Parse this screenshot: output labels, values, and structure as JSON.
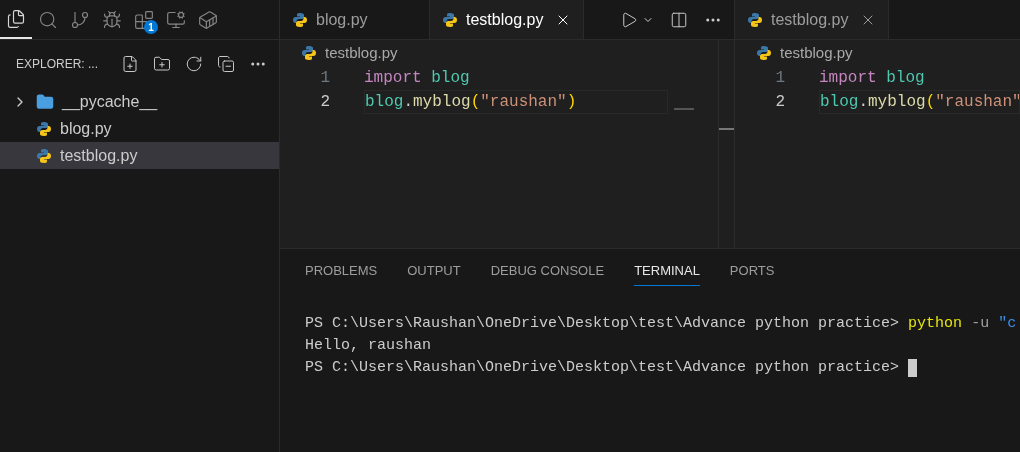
{
  "activity_bar": [
    {
      "kind": "files",
      "selected": true
    },
    {
      "kind": "search",
      "selected": false
    },
    {
      "kind": "source-control",
      "selected": false
    },
    {
      "kind": "run",
      "selected": false
    },
    {
      "kind": "extensions",
      "selected": false,
      "badge": "1"
    },
    {
      "kind": "remote",
      "selected": false
    },
    {
      "kind": "docker",
      "selected": false
    }
  ],
  "sidebar": {
    "title": "EXPLORER: ...",
    "items": [
      {
        "kind": "folder",
        "label": "__pycache__",
        "expanded": false,
        "selected": false
      },
      {
        "kind": "file",
        "label": "blog.py",
        "selected": false
      },
      {
        "kind": "file",
        "label": "testblog.py",
        "selected": true
      }
    ]
  },
  "editor_groups": [
    {
      "tabs": [
        {
          "label": "blog.py",
          "selected": false
        },
        {
          "label": "testblog.py",
          "selected": true
        }
      ],
      "actions": [
        {
          "kind": "run"
        },
        {
          "kind": "split"
        },
        {
          "kind": "more"
        }
      ],
      "breadcrumb": "testblog.py",
      "lines": [
        {
          "number": "1",
          "current": false,
          "tokens": [
            {
              "kind": "keyword",
              "text": "import "
            },
            {
              "kind": "module",
              "text": "blog"
            }
          ]
        },
        {
          "number": "2",
          "current": true,
          "tokens": [
            {
              "kind": "module",
              "text": "blog"
            },
            {
              "kind": "plain",
              "text": "."
            },
            {
              "kind": "function",
              "text": "myblog"
            },
            {
              "kind": "paren",
              "text": "("
            },
            {
              "kind": "string",
              "text": "\"raushan\""
            },
            {
              "kind": "paren",
              "text": ")"
            }
          ]
        }
      ]
    },
    {
      "tabs": [
        {
          "label": "testblog.py",
          "selected": true
        }
      ],
      "breadcrumb": "testblog.py",
      "lines": [
        {
          "number": "1",
          "current": false,
          "tokens": [
            {
              "kind": "keyword",
              "text": "import "
            },
            {
              "kind": "module",
              "text": "blog"
            }
          ]
        },
        {
          "number": "2",
          "current": true,
          "tokens": [
            {
              "kind": "module",
              "text": "blog"
            },
            {
              "kind": "plain",
              "text": "."
            },
            {
              "kind": "function",
              "text": "myblog"
            },
            {
              "kind": "paren",
              "text": "("
            },
            {
              "kind": "string",
              "text": "\"raushan\""
            }
          ]
        }
      ]
    }
  ],
  "panel": {
    "tabs": [
      {
        "label": "PROBLEMS",
        "selected": false
      },
      {
        "label": "OUTPUT",
        "selected": false
      },
      {
        "label": "DEBUG CONSOLE",
        "selected": false
      },
      {
        "label": "TERMINAL",
        "selected": true
      },
      {
        "label": "PORTS",
        "selected": false
      }
    ],
    "terminal": [
      [
        {
          "kind": "plain",
          "text": "PS C:\\Users\\Raushan\\OneDrive\\Desktop\\test\\Advance python practice> "
        },
        {
          "kind": "command",
          "text": "python"
        },
        {
          "kind": "flag",
          "text": " -u "
        },
        {
          "kind": "string",
          "text": "\"c"
        }
      ],
      [
        {
          "kind": "plain",
          "text": "Hello, raushan"
        }
      ],
      [
        {
          "kind": "plain",
          "text": "PS C:\\Users\\Raushan\\OneDrive\\Desktop\\test\\Advance python practice> "
        },
        {
          "kind": "cursor"
        }
      ]
    ]
  }
}
